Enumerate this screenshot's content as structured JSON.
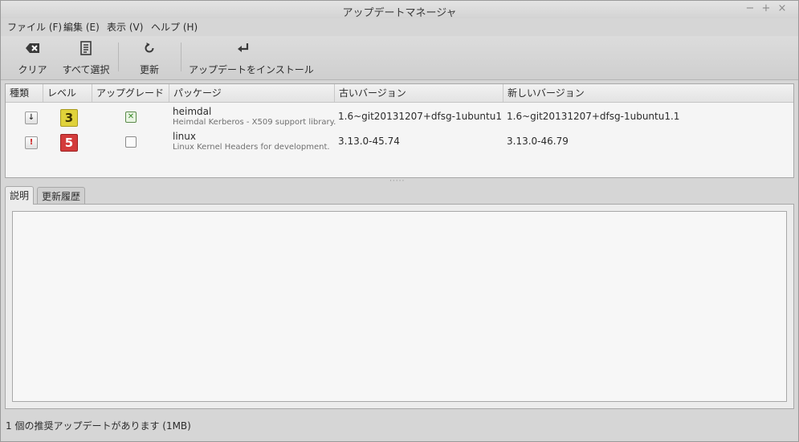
{
  "window": {
    "title": "アップデートマネージャ",
    "controls": {
      "minimize": "−",
      "maximize": "+",
      "close": "×"
    }
  },
  "menu": [
    {
      "label": "ファイル (F)"
    },
    {
      "label": "編集 (E)"
    },
    {
      "label": "表示 (V)"
    },
    {
      "label": "ヘルプ (H)"
    }
  ],
  "toolbar": {
    "clear": {
      "label": "クリア",
      "icon": "backspace-icon"
    },
    "select_all": {
      "label": "すべて選択",
      "icon": "document-list-icon"
    },
    "refresh": {
      "label": "更新",
      "icon": "refresh-icon"
    },
    "install": {
      "label": "アップデートをインストール",
      "icon": "enter-arrow-icon"
    }
  },
  "table": {
    "columns": [
      "種類",
      "レベル",
      "アップグレード",
      "パッケージ",
      "古いバージョン",
      "新しいバージョン"
    ],
    "rows": [
      {
        "type_icon": "download-icon",
        "type_glyph": "↓",
        "type_color": "#333333",
        "level": "3",
        "level_color": "#e0d23a",
        "upgrade_checked": true,
        "check_glyph": "✕",
        "name": "heimdal",
        "description": "Heimdal Kerberos - X509 support library.",
        "old_version": "1.6~git20131207+dfsg-1ubuntu1",
        "new_version": "1.6~git20131207+dfsg-1ubuntu1.1"
      },
      {
        "type_icon": "warning-icon",
        "type_glyph": "!",
        "type_color": "#cc1f1f",
        "level": "5",
        "level_color": "#d33b3b",
        "upgrade_checked": false,
        "check_glyph": "",
        "name": "linux",
        "description": "Linux Kernel Headers for development.",
        "old_version": "3.13.0-45.74",
        "new_version": "3.13.0-46.79"
      }
    ]
  },
  "tabs": [
    {
      "label": "説明",
      "active": true
    },
    {
      "label": "更新履歴",
      "active": false
    }
  ],
  "status": {
    "text": "1 個の推奨アップデートがあります (1MB)"
  }
}
